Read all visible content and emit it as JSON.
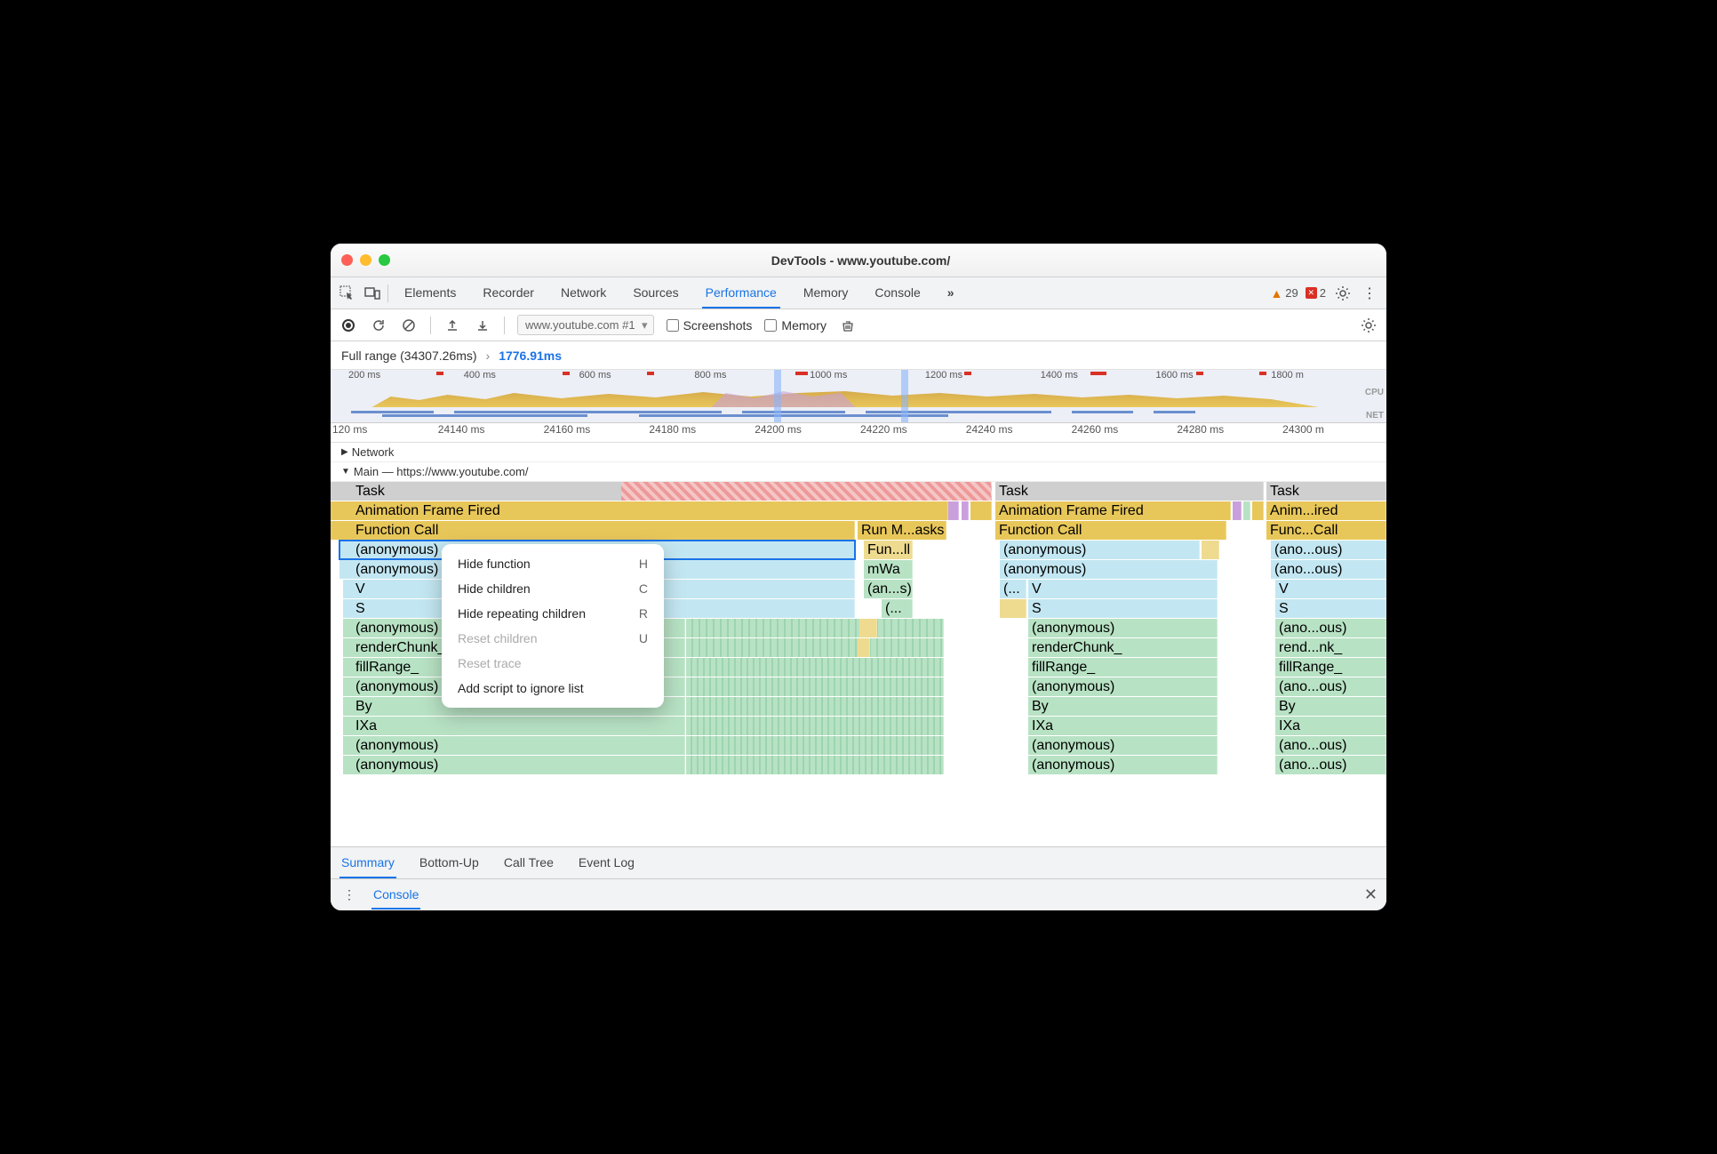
{
  "window": {
    "title": "DevTools - www.youtube.com/"
  },
  "tabs": [
    "Elements",
    "Recorder",
    "Network",
    "Sources",
    "Performance",
    "Memory",
    "Console"
  ],
  "active_tab": "Performance",
  "more_tabs_glyph": "»",
  "issues": {
    "warnings": 29,
    "errors": 2
  },
  "toolbar": {
    "profile_select": "www.youtube.com #1",
    "screenshots_label": "Screenshots",
    "memory_label": "Memory"
  },
  "breadcrumb": {
    "full": "Full range (34307.26ms)",
    "selected": "1776.91ms"
  },
  "overview_ticks": [
    "200 ms",
    "400 ms",
    "600 ms",
    "800 ms",
    "1000 ms",
    "1200 ms",
    "1400 ms",
    "1600 ms",
    "1800 m"
  ],
  "overview_labels": {
    "cpu": "CPU",
    "net": "NET"
  },
  "ruler_ticks": [
    "120 ms",
    "24140 ms",
    "24160 ms",
    "24180 ms",
    "24200 ms",
    "24220 ms",
    "24240 ms",
    "24260 ms",
    "24280 ms",
    "24300 m"
  ],
  "tracks": {
    "network": "Network",
    "main": "Main — https://www.youtube.com/"
  },
  "flame": {
    "col1": {
      "task": "Task",
      "af": "Animation Frame Fired",
      "fc": "Function Call",
      "run": "Run M...asks",
      "anon1": "(anonymous)",
      "fun": "Fun...ll",
      "anon2": "(anonymous)",
      "mwa": "mWa",
      "v": "V",
      "ans": "(an...s)",
      "s": "S",
      "dots": "(...",
      "anon3": "(anonymous)",
      "rc": "renderChunk_",
      "fr": "fillRange_",
      "anon4": "(anonymous)",
      "by": "By",
      "ixa": "IXa",
      "anon5": "(anonymous)",
      "anon6": "(anonymous)"
    },
    "col2": {
      "task": "Task",
      "af": "Animation Frame Fired",
      "fc": "Function Call",
      "anon1": "(anonymous)",
      "anon2": "(anonymous)",
      "par": "(...",
      "v": "V",
      "s": "S",
      "anon3": "(anonymous)",
      "rc": "renderChunk_",
      "fr": "fillRange_",
      "anon4": "(anonymous)",
      "by": "By",
      "ixa": "IXa",
      "anon5": "(anonymous)",
      "anon6": "(anonymous)"
    },
    "col3": {
      "task": "Task",
      "af": "Anim...ired",
      "fc": "Func...Call",
      "anon1": "(ano...ous)",
      "anon2": "(ano...ous)",
      "v": "V",
      "s": "S",
      "anon3": "(ano...ous)",
      "rc": "rend...nk_",
      "fr": "fillRange_",
      "anon4": "(ano...ous)",
      "by": "By",
      "ixa": "IXa",
      "anon5": "(ano...ous)",
      "anon6": "(ano...ous)"
    }
  },
  "bottom_tabs": [
    "Summary",
    "Bottom-Up",
    "Call Tree",
    "Event Log"
  ],
  "active_bottom_tab": "Summary",
  "drawer": {
    "console": "Console"
  },
  "context_menu": {
    "items": [
      {
        "label": "Hide function",
        "short": "H",
        "enabled": true
      },
      {
        "label": "Hide children",
        "short": "C",
        "enabled": true
      },
      {
        "label": "Hide repeating children",
        "short": "R",
        "enabled": true
      },
      {
        "label": "Reset children",
        "short": "U",
        "enabled": false
      },
      {
        "label": "Reset trace",
        "short": "",
        "enabled": false
      },
      {
        "label": "Add script to ignore list",
        "short": "",
        "enabled": true
      }
    ]
  }
}
